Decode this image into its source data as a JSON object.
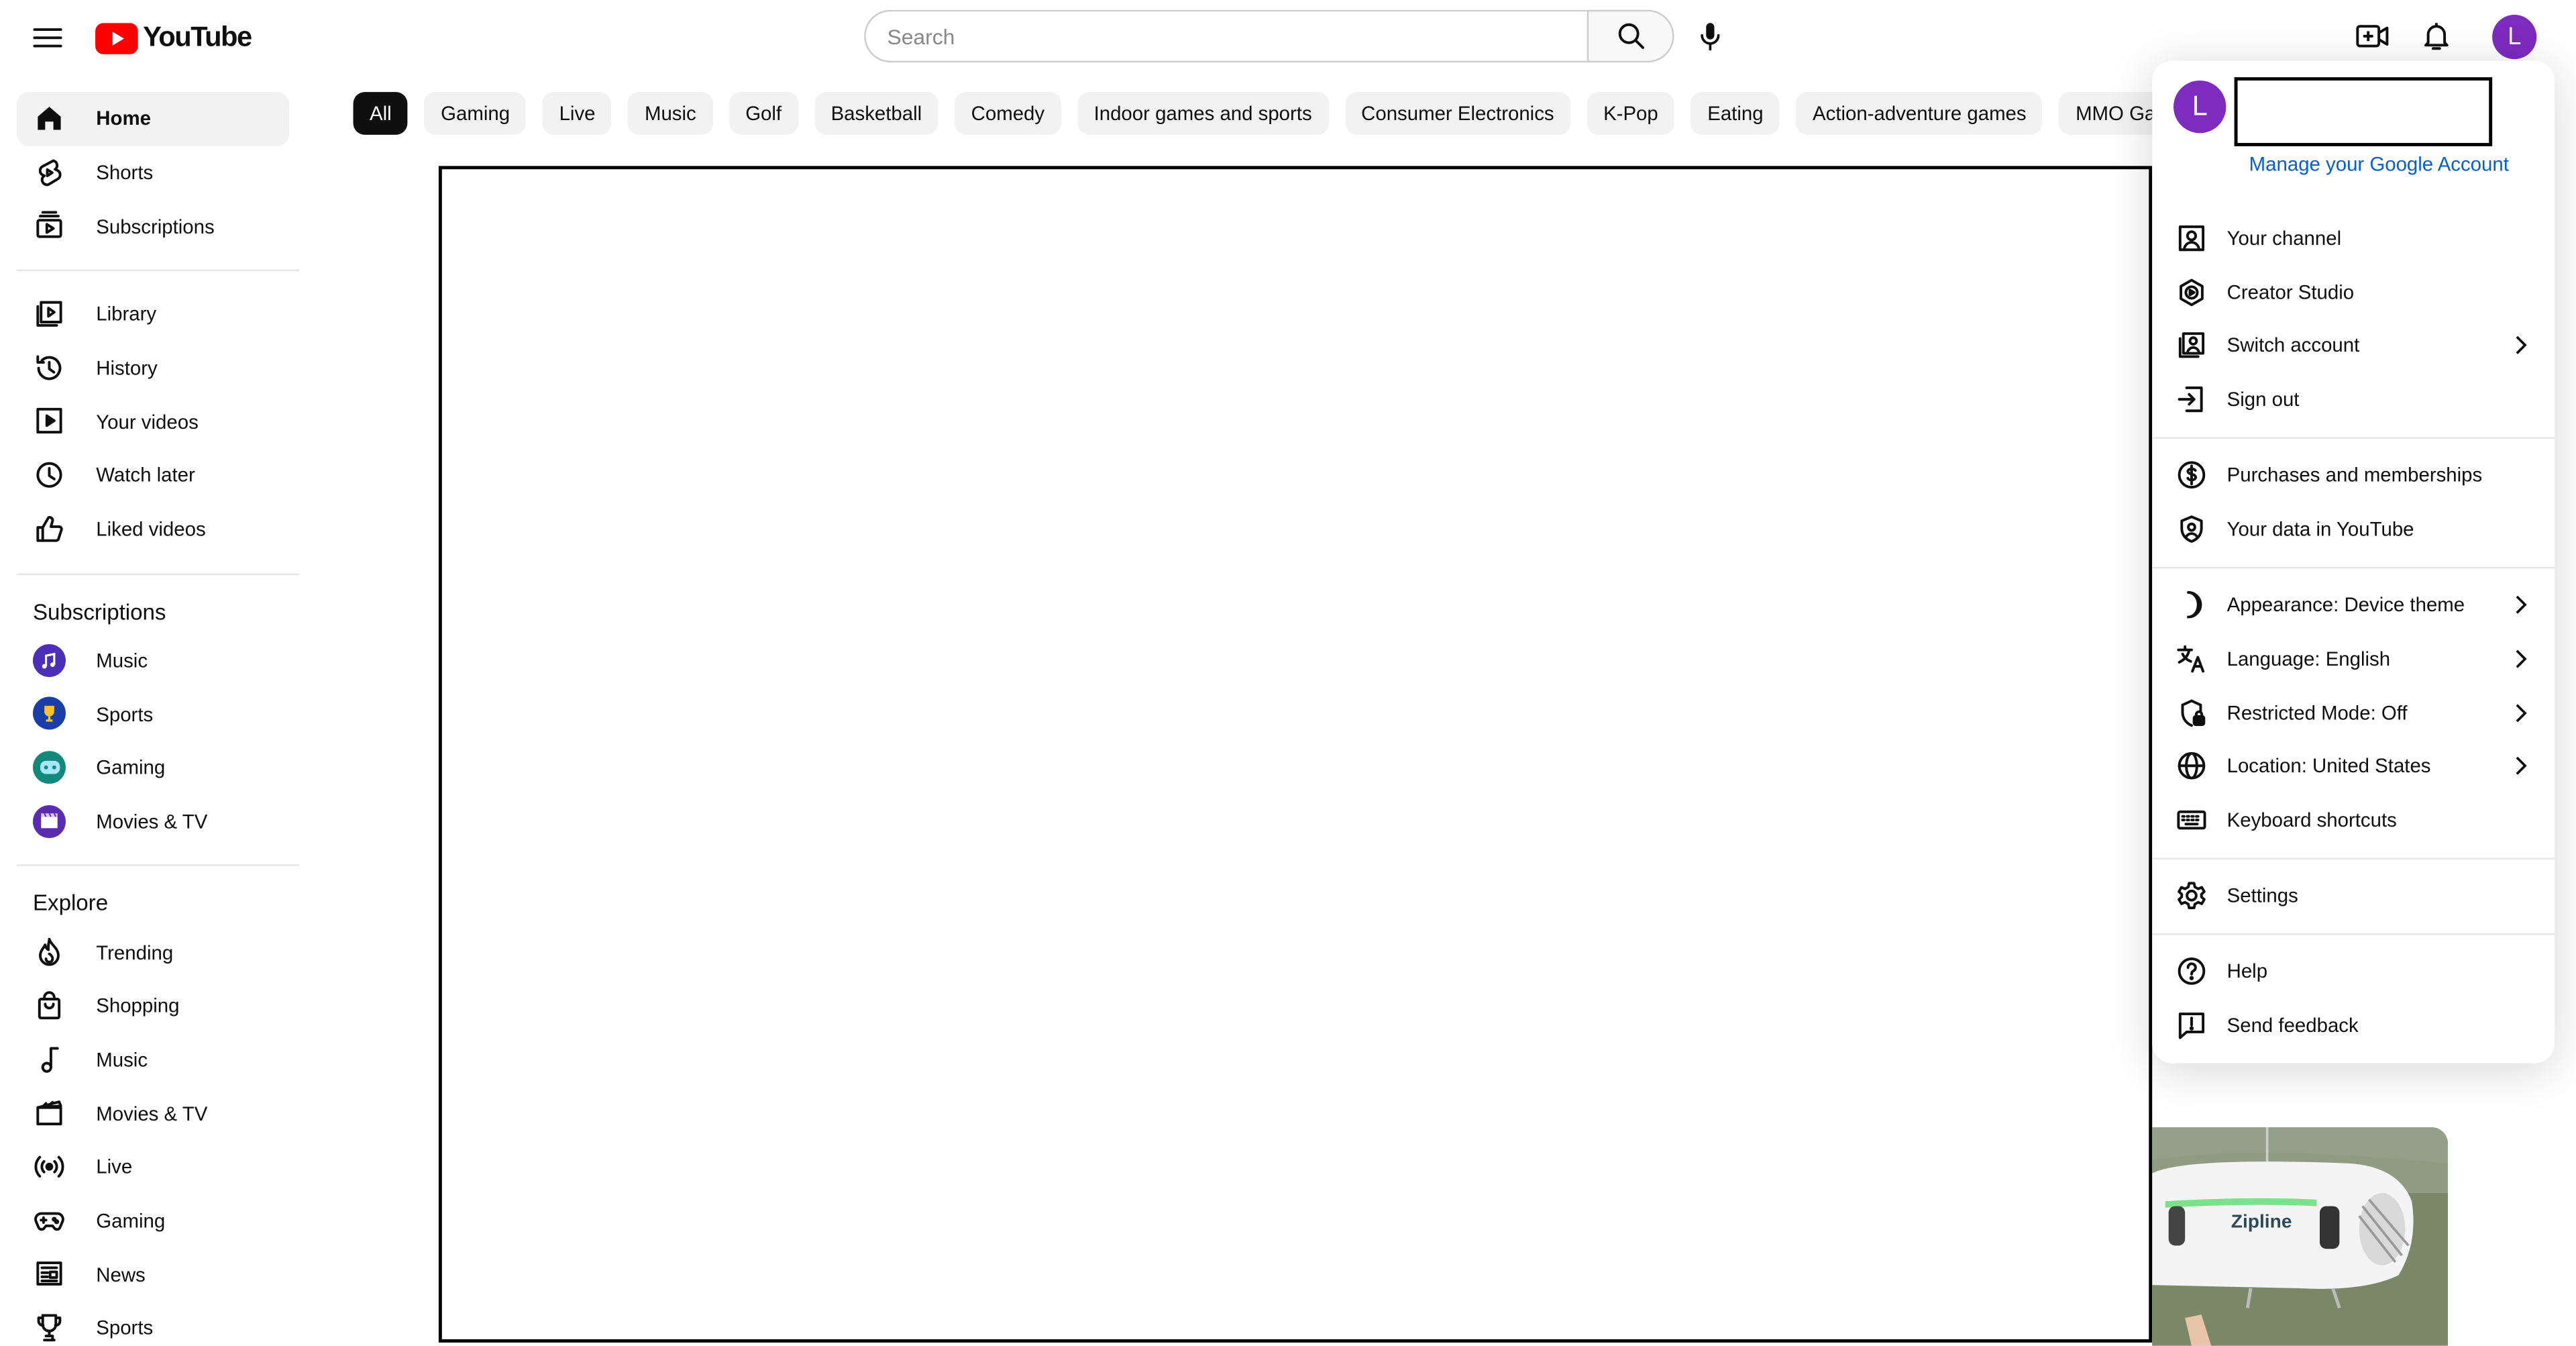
{
  "header": {
    "logo_text": "YouTube",
    "search_placeholder": "Search",
    "avatar_letter": "L"
  },
  "sidebar": {
    "primary": [
      {
        "label": "Home",
        "icon": "home-icon",
        "active": true
      },
      {
        "label": "Shorts",
        "icon": "shorts-icon"
      },
      {
        "label": "Subscriptions",
        "icon": "subscriptions-icon"
      }
    ],
    "library": [
      {
        "label": "Library",
        "icon": "library-icon"
      },
      {
        "label": "History",
        "icon": "history-icon"
      },
      {
        "label": "Your videos",
        "icon": "your-videos-icon"
      },
      {
        "label": "Watch later",
        "icon": "watch-later-icon"
      },
      {
        "label": "Liked videos",
        "icon": "liked-videos-icon"
      }
    ],
    "subscriptions_title": "Subscriptions",
    "subscriptions": [
      {
        "label": "Music",
        "color": "#4b2fb8",
        "icon": "music-channel-icon"
      },
      {
        "label": "Sports",
        "color": "#1a3ea8",
        "icon": "sports-channel-icon"
      },
      {
        "label": "Gaming",
        "color": "#12897a",
        "icon": "gaming-channel-icon"
      },
      {
        "label": "Movies & TV",
        "color": "#5a2cb0",
        "icon": "movies-channel-icon"
      }
    ],
    "explore_title": "Explore",
    "explore": [
      {
        "label": "Trending",
        "icon": "trending-icon"
      },
      {
        "label": "Shopping",
        "icon": "shopping-icon"
      },
      {
        "label": "Music",
        "icon": "music-icon"
      },
      {
        "label": "Movies & TV",
        "icon": "movies-icon"
      },
      {
        "label": "Live",
        "icon": "live-icon"
      },
      {
        "label": "Gaming",
        "icon": "gaming-icon"
      },
      {
        "label": "News",
        "icon": "news-icon"
      },
      {
        "label": "Sports",
        "icon": "sports-icon"
      }
    ]
  },
  "chips": [
    "All",
    "Gaming",
    "Live",
    "Music",
    "Golf",
    "Basketball",
    "Comedy",
    "Indoor games and sports",
    "Consumer Electronics",
    "K-Pop",
    "Eating",
    "Action-adventure games",
    "MMO Game"
  ],
  "thumbnail": {
    "brand_text": "Zipline"
  },
  "account_menu": {
    "avatar_letter": "L",
    "manage_link": "Manage your Google Account",
    "groups": [
      [
        {
          "label": "Your channel",
          "icon": "your-channel-icon"
        },
        {
          "label": "Creator Studio",
          "icon": "creator-studio-icon"
        },
        {
          "label": "Switch account",
          "icon": "switch-account-icon",
          "chevron": true
        },
        {
          "label": "Sign out",
          "icon": "sign-out-icon"
        }
      ],
      [
        {
          "label": "Purchases and memberships",
          "icon": "purchases-icon"
        },
        {
          "label": "Your data in YouTube",
          "icon": "your-data-icon"
        }
      ],
      [
        {
          "label": "Appearance: Device theme",
          "icon": "appearance-icon",
          "chevron": true
        },
        {
          "label": "Language: English",
          "icon": "language-icon",
          "chevron": true
        },
        {
          "label": "Restricted Mode: Off",
          "icon": "restricted-mode-icon",
          "chevron": true
        },
        {
          "label": "Location: United States",
          "icon": "location-icon",
          "chevron": true
        },
        {
          "label": "Keyboard shortcuts",
          "icon": "keyboard-icon"
        }
      ],
      [
        {
          "label": "Settings",
          "icon": "settings-icon"
        }
      ],
      [
        {
          "label": "Help",
          "icon": "help-icon"
        },
        {
          "label": "Send feedback",
          "icon": "send-feedback-icon"
        }
      ]
    ]
  },
  "colors": {
    "brand_red": "#ff0000",
    "avatar_purple": "#7e2bbf",
    "link_blue": "#065fd4"
  }
}
